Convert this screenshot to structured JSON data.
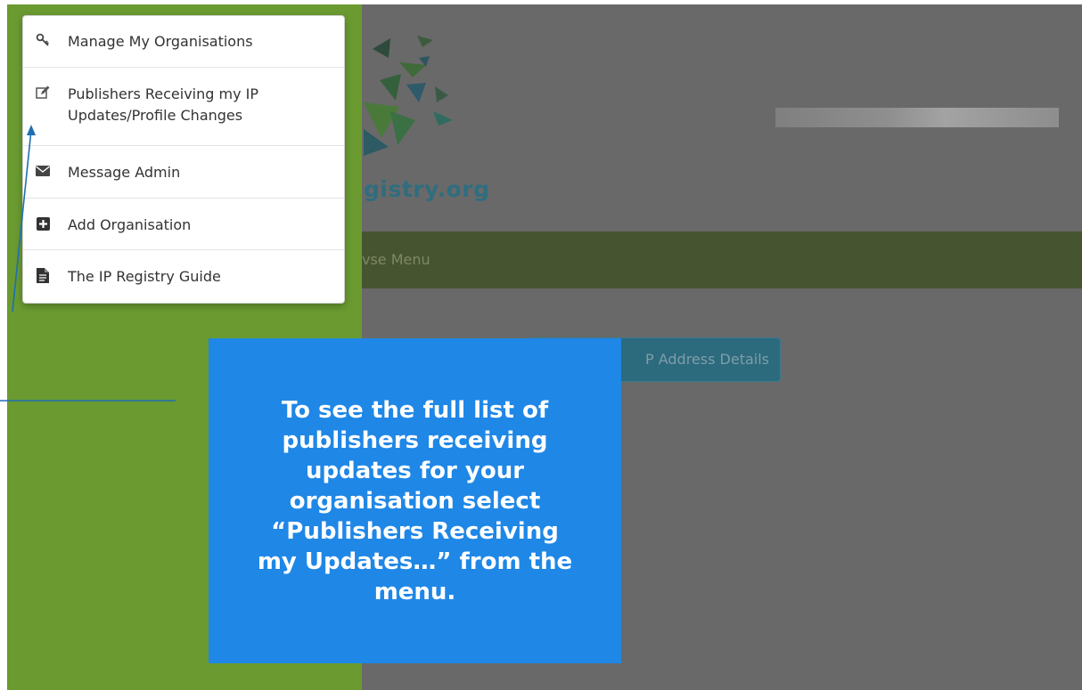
{
  "menu": {
    "items": [
      {
        "icon": "key-icon",
        "label_line1": "Manage My Organisations",
        "label_line2": ""
      },
      {
        "icon": "edit-icon",
        "label_line1": "Publishers Receiving my IP",
        "label_line2": "Updates/Profile Changes"
      },
      {
        "icon": "envelope-icon",
        "label_line1": "Message Admin",
        "label_line2": ""
      },
      {
        "icon": "plus-square-icon",
        "label_line1": "Add Organisation",
        "label_line2": ""
      },
      {
        "icon": "file-icon",
        "label_line1": "The IP Registry Guide",
        "label_line2": ""
      }
    ]
  },
  "logo": {
    "text": "gistry.org"
  },
  "menu_bar": {
    "label": "vse Menu"
  },
  "ip_button": {
    "label": "P Address Details"
  },
  "callout": {
    "text": "To see the full list of publishers receiving updates for your organisation select “Publishers Receiving my Updates…” from the menu."
  },
  "colors": {
    "sidebar": "#6a9a30",
    "overlay": "#696969",
    "callout": "#1f87e6",
    "menu_bar": "#46542f",
    "logo_text": "#2f6d7f"
  }
}
